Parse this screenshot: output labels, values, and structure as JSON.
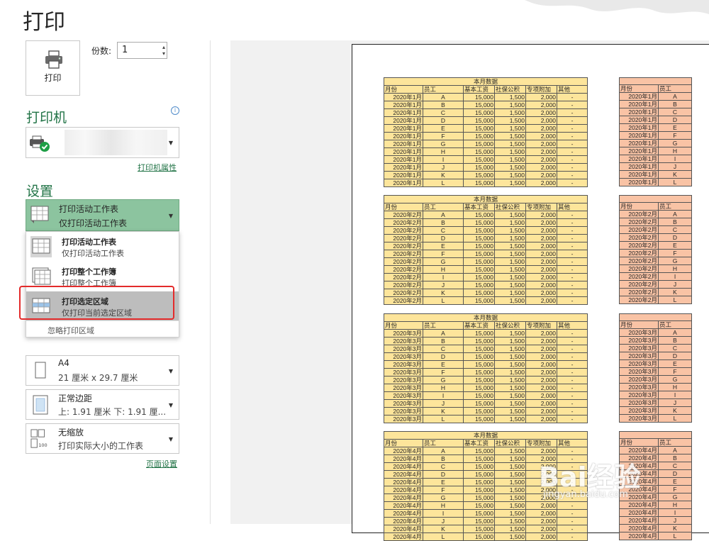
{
  "title": "打印",
  "print_button": {
    "label": "打印"
  },
  "copies": {
    "label": "份数:",
    "value": "1"
  },
  "printer": {
    "heading": "打印机",
    "properties_link": "打印机属性"
  },
  "settings": {
    "heading": "设置",
    "selected": {
      "main": "打印活动工作表",
      "sub": "仅打印活动工作表"
    },
    "dropdown": {
      "items": [
        {
          "main": "打印活动工作表",
          "sub": "仅打印活动工作表"
        },
        {
          "main": "打印整个工作簿",
          "sub": "打印整个工作簿"
        },
        {
          "main": "打印选定区域",
          "sub": "仅打印当前选定区域"
        }
      ],
      "ignore_area": "忽略打印区域"
    },
    "paper": {
      "main": "A4",
      "sub": "21 厘米 x 29.7 厘米"
    },
    "margins": {
      "main": "正常边距",
      "sub": "上: 1.91 厘米 下: 1.91 厘..."
    },
    "scaling": {
      "main": "无缩放",
      "sub": "打印实际大小的工作表",
      "icon_text": "100"
    },
    "page_setup_link": "页面设置"
  },
  "preview": {
    "table_title": "本月数据",
    "headers": [
      "月份",
      "员工",
      "基本工资",
      "社保公积",
      "专项附加",
      "其他"
    ],
    "employees": [
      "A",
      "B",
      "C",
      "D",
      "E",
      "F",
      "G",
      "H",
      "I",
      "J",
      "K",
      "L"
    ],
    "row_values": [
      "15,000",
      "1,500",
      "2,000",
      "-"
    ],
    "months": [
      "2020年1月",
      "2020年2月",
      "2020年3月",
      "2020年4月"
    ]
  },
  "watermark": {
    "main": "Bai经验",
    "sub": "jingyan.baidu.com"
  },
  "colors": {
    "accent": "#217346",
    "selected_bg": "#8cc49f",
    "highlight": "#e32b2b",
    "table_yellow": "#fde59b",
    "table_orange": "#f9c3a5"
  }
}
